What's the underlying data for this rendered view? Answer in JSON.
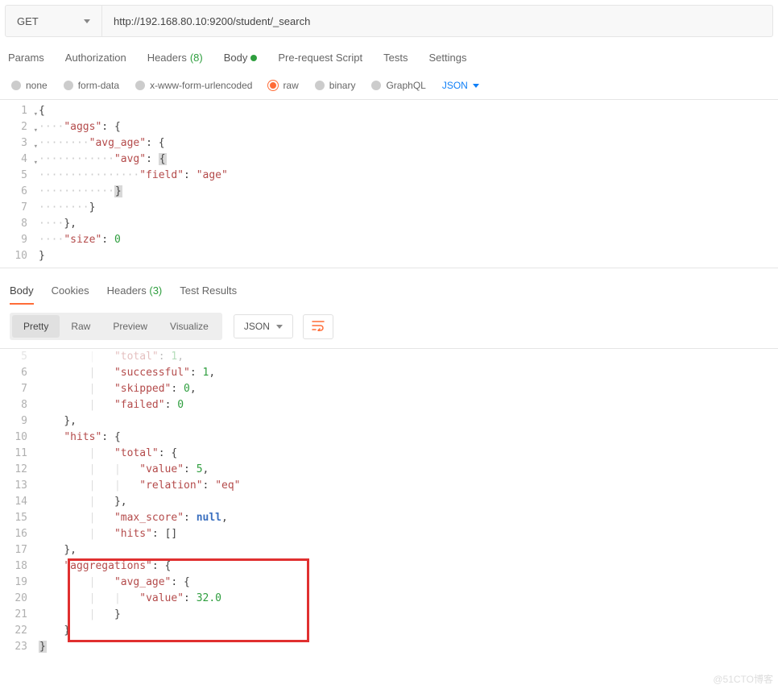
{
  "request": {
    "method": "GET",
    "url": "http://192.168.80.10:9200/student/_search",
    "tabs": {
      "params": "Params",
      "authorization": "Authorization",
      "headers": "Headers",
      "headers_count": "(8)",
      "body": "Body",
      "prerequest": "Pre-request Script",
      "tests": "Tests",
      "settings": "Settings"
    },
    "body_types": {
      "none": "none",
      "formdata": "form-data",
      "urlencoded": "x-www-form-urlencoded",
      "raw": "raw",
      "binary": "binary",
      "graphql": "GraphQL",
      "format": "JSON"
    },
    "editor_lines": [
      {
        "n": "1",
        "html": "<span class='k-punc'>{</span>",
        "fold": true
      },
      {
        "n": "2",
        "html": "<span class='dots'>····</span><span class='k-key'>\"aggs\"</span><span class='k-punc'>:</span> <span class='k-punc'>{</span>",
        "fold": true
      },
      {
        "n": "3",
        "html": "<span class='dots'>········</span><span class='k-key'>\"avg_age\"</span><span class='k-punc'>:</span> <span class='k-punc'>{</span>",
        "fold": true
      },
      {
        "n": "4",
        "html": "<span class='dots'>············</span><span class='k-key'>\"avg\"</span><span class='k-punc'>:</span> <span class='brace-hl'>{</span>",
        "fold": true
      },
      {
        "n": "5",
        "html": "<span class='dots'>················</span><span class='k-key'>\"field\"</span><span class='k-punc'>:</span> <span class='k-str'>\"age\"</span>"
      },
      {
        "n": "6",
        "html": "<span class='dots'>············</span><span class='brace-hl'>}</span>"
      },
      {
        "n": "7",
        "html": "<span class='dots'>········</span><span class='k-punc'>}</span>"
      },
      {
        "n": "8",
        "html": "<span class='dots'>····</span><span class='k-punc'>},</span>"
      },
      {
        "n": "9",
        "html": "<span class='dots'>····</span><span class='k-key'>\"size\"</span><span class='k-punc'>:</span> <span class='k-num'>0</span>"
      },
      {
        "n": "10",
        "html": "<span class='k-punc'>}</span>"
      }
    ]
  },
  "response": {
    "tabs": {
      "body": "Body",
      "cookies": "Cookies",
      "headers": "Headers",
      "headers_count": "(3)",
      "tests": "Test Results"
    },
    "views": {
      "pretty": "Pretty",
      "raw": "Raw",
      "preview": "Preview",
      "visualize": "Visualize",
      "format": "JSON"
    },
    "lines": [
      {
        "n": "5",
        "html": "        <span class='guide'>|</span>   <span class='k-key'>\"total\"</span><span class='k-punc'>:</span> <span class='k-num'>1</span><span class='k-punc'>,</span>",
        "faded": true
      },
      {
        "n": "6",
        "html": "        <span class='guide'>|</span>   <span class='k-key'>\"successful\"</span><span class='k-punc'>:</span> <span class='k-num'>1</span><span class='k-punc'>,</span>"
      },
      {
        "n": "7",
        "html": "        <span class='guide'>|</span>   <span class='k-key'>\"skipped\"</span><span class='k-punc'>:</span> <span class='k-num'>0</span><span class='k-punc'>,</span>"
      },
      {
        "n": "8",
        "html": "        <span class='guide'>|</span>   <span class='k-key'>\"failed\"</span><span class='k-punc'>:</span> <span class='k-num'>0</span>"
      },
      {
        "n": "9",
        "html": "    <span class='k-punc'>},</span>"
      },
      {
        "n": "10",
        "html": "    <span class='k-key'>\"hits\"</span><span class='k-punc'>:</span> <span class='k-punc'>{</span>"
      },
      {
        "n": "11",
        "html": "        <span class='guide'>|</span>   <span class='k-key'>\"total\"</span><span class='k-punc'>:</span> <span class='k-punc'>{</span>"
      },
      {
        "n": "12",
        "html": "        <span class='guide'>|</span>   <span class='guide'>|</span>   <span class='k-key'>\"value\"</span><span class='k-punc'>:</span> <span class='k-num'>5</span><span class='k-punc'>,</span>"
      },
      {
        "n": "13",
        "html": "        <span class='guide'>|</span>   <span class='guide'>|</span>   <span class='k-key'>\"relation\"</span><span class='k-punc'>:</span> <span class='k-str'>\"eq\"</span>"
      },
      {
        "n": "14",
        "html": "        <span class='guide'>|</span>   <span class='k-punc'>},</span>"
      },
      {
        "n": "15",
        "html": "        <span class='guide'>|</span>   <span class='k-key'>\"max_score\"</span><span class='k-punc'>:</span> <span class='k-null'>null</span><span class='k-punc'>,</span>"
      },
      {
        "n": "16",
        "html": "        <span class='guide'>|</span>   <span class='k-key'>\"hits\"</span><span class='k-punc'>:</span> <span class='k-punc'>[]</span>"
      },
      {
        "n": "17",
        "html": "    <span class='k-punc'>},</span>"
      },
      {
        "n": "18",
        "html": "    <span class='k-key'>\"aggregations\"</span><span class='k-punc'>:</span> <span class='k-punc'>{</span>"
      },
      {
        "n": "19",
        "html": "        <span class='guide'>|</span>   <span class='k-key'>\"avg_age\"</span><span class='k-punc'>:</span> <span class='k-punc'>{</span>"
      },
      {
        "n": "20",
        "html": "        <span class='guide'>|</span>   <span class='guide'>|</span>   <span class='k-key'>\"value\"</span><span class='k-punc'>:</span> <span class='k-num'>32.0</span>"
      },
      {
        "n": "21",
        "html": "        <span class='guide'>|</span>   <span class='k-punc'>}</span>"
      },
      {
        "n": "22",
        "html": "    <span class='k-punc'>}</span>"
      },
      {
        "n": "23",
        "html": "<span class='brace-hl'>}</span>"
      }
    ]
  },
  "watermark": "@51CTO博客"
}
